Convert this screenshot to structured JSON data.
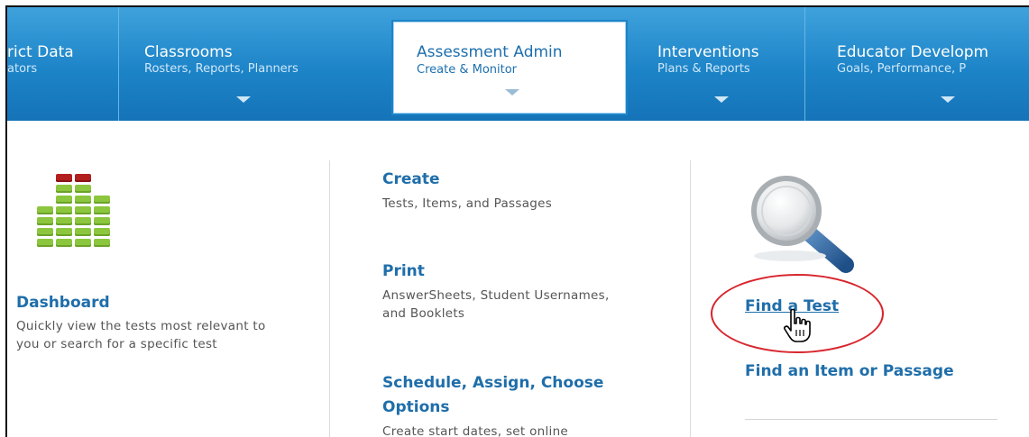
{
  "nav": {
    "items": [
      {
        "title": "rict Data",
        "subtitle": "ators"
      },
      {
        "title": "Classrooms",
        "subtitle": "Rosters, Reports, Planners"
      },
      {
        "title": "Assessment Admin",
        "subtitle": "Create & Monitor"
      },
      {
        "title": "Interventions",
        "subtitle": "Plans & Reports"
      },
      {
        "title": "Educator Developm",
        "subtitle": "Goals, Performance, P"
      }
    ]
  },
  "dashboard": {
    "title": "Dashboard",
    "description": "Quickly view the tests most relevant to you or search for a specific test"
  },
  "middle": {
    "create_title": "Create",
    "create_desc": "Tests, Items, and Passages",
    "print_title": "Print",
    "print_desc": "AnswerSheets, Student Usernames, and Booklets",
    "schedule_title": "Schedule, Assign, Choose Options",
    "schedule_desc": "Create start dates, set online"
  },
  "right": {
    "find_test": "Find a Test",
    "find_item": "Find an Item or Passage"
  },
  "colors": {
    "nav_blue": "#1d84c8",
    "link_blue": "#1f6eaa",
    "highlight_red": "#d8262e"
  }
}
